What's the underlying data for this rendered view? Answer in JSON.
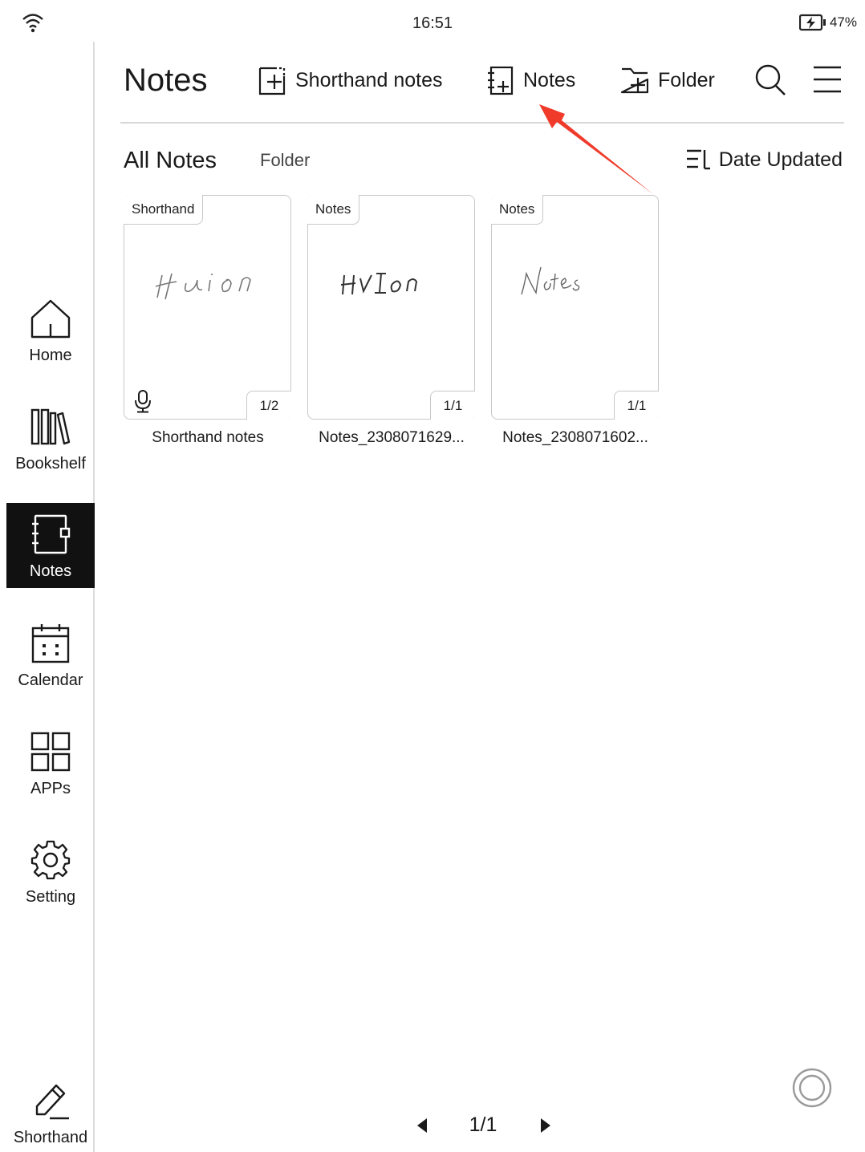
{
  "status_bar": {
    "time": "16:51",
    "battery_percent": "47%",
    "icons": [
      "wifi-icon",
      "battery-charging-icon"
    ]
  },
  "sidebar": {
    "items": [
      {
        "label": "Home",
        "icon": "home-icon",
        "active": false
      },
      {
        "label": "Bookshelf",
        "icon": "bookshelf-icon",
        "active": false
      },
      {
        "label": "Notes",
        "icon": "notebook-icon",
        "active": true
      },
      {
        "label": "Calendar",
        "icon": "calendar-icon",
        "active": false
      },
      {
        "label": "APPs",
        "icon": "apps-grid-icon",
        "active": false
      },
      {
        "label": "Setting",
        "icon": "gear-icon",
        "active": false
      }
    ],
    "shorthand": {
      "label": "Shorthand",
      "icon": "pen-icon"
    }
  },
  "header": {
    "title": "Notes",
    "new_shorthand_label": "Shorthand notes",
    "new_notes_label": "Notes",
    "new_folder_label": "Folder",
    "icons": [
      "new-shorthand-icon",
      "new-notebook-icon",
      "new-folder-icon",
      "search-icon",
      "menu-icon"
    ]
  },
  "tabs": {
    "all_notes": "All Notes",
    "folder": "Folder"
  },
  "sort": {
    "label": "Date Updated",
    "icon": "sort-icon"
  },
  "notes": [
    {
      "tag": "Shorthand",
      "pages": "1/2",
      "name": "Shorthand notes",
      "has_audio": true
    },
    {
      "tag": "Notes",
      "pages": "1/1",
      "name": "Notes_2308071629...",
      "has_audio": false
    },
    {
      "tag": "Notes",
      "pages": "1/1",
      "name": "Notes_2308071602...",
      "has_audio": false
    }
  ],
  "pagination": {
    "current": "1/1"
  },
  "annotation": {
    "arrow_color": "#f03a2a"
  }
}
